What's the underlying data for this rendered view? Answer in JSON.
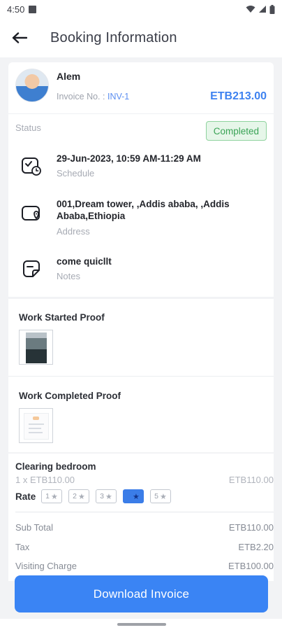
{
  "status_bar": {
    "time": "4:50"
  },
  "header": {
    "title": "Booking Information"
  },
  "provider": {
    "name": "Alem",
    "invoice_label": "Invoice No. :",
    "invoice_no": "INV-1",
    "amount": "ETB213.00"
  },
  "status": {
    "label": "Status",
    "value": "Completed"
  },
  "schedule": {
    "value": "29-Jun-2023, 10:59 AM-11:29 AM",
    "label": "Schedule"
  },
  "address": {
    "value": "001,Dream tower, ,Addis ababa, ,Addis Ababa,Ethiopia",
    "label": "Address"
  },
  "notes": {
    "value": "come quicllt",
    "label": "Notes"
  },
  "proofs": {
    "started": "Work Started Proof",
    "completed": "Work Completed Proof"
  },
  "service": {
    "name": "Clearing bedroom",
    "qty": "1 x ETB110.00",
    "amount": "ETB110.00"
  },
  "rating": {
    "label": "Rate",
    "options": [
      "1",
      "2",
      "3",
      "4",
      "5"
    ],
    "selected": 4
  },
  "summary": {
    "subtotal_label": "Sub Total",
    "subtotal": "ETB110.00",
    "tax_label": "Tax",
    "tax": "ETB2.20",
    "visiting_label": "Visiting Charge",
    "visiting": "ETB100.00"
  },
  "actions": {
    "download": "Download Invoice"
  },
  "colors": {
    "accent": "#3a84f4",
    "completed": "#3aa356"
  }
}
